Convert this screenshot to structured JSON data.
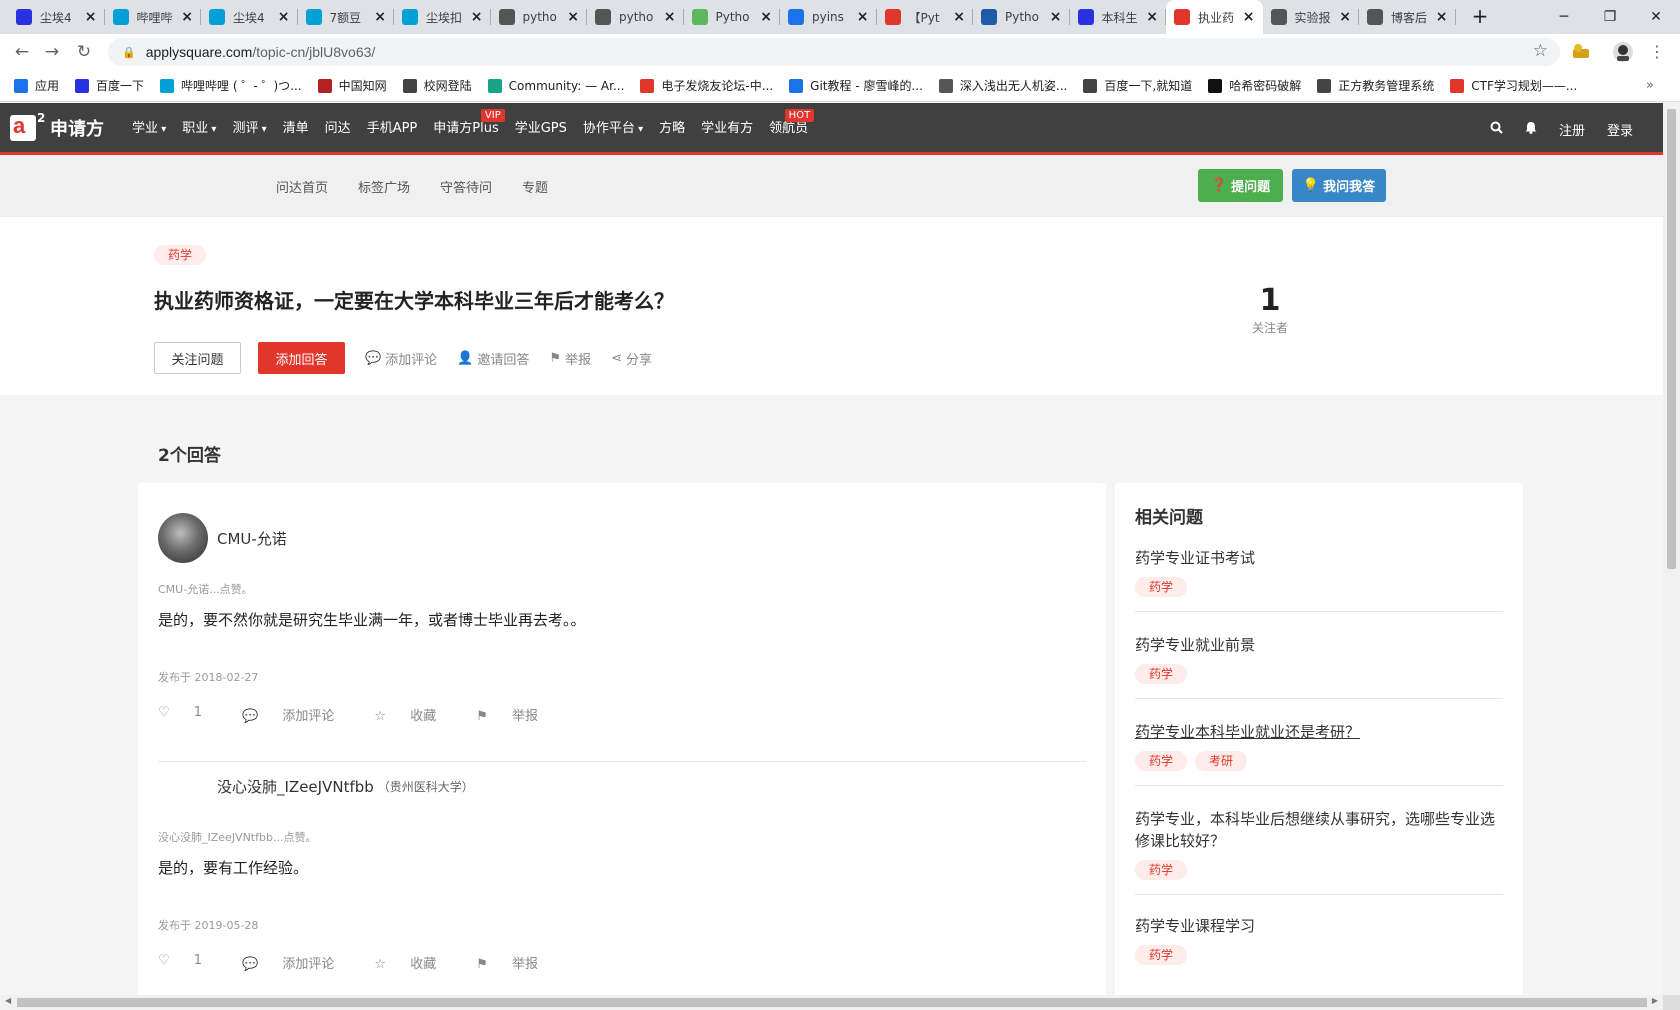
{
  "browser": {
    "tabs": [
      {
        "title": "尘埃4",
        "icon": "baidu-paw-icon",
        "color": "#2932e1"
      },
      {
        "title": "哔哩哔",
        "icon": "bilibili-icon",
        "color": "#00a1d6"
      },
      {
        "title": "尘埃4",
        "icon": "bilibili-icon",
        "color": "#00a1d6"
      },
      {
        "title": "7额豆",
        "icon": "bilibili-icon",
        "color": "#00a1d6"
      },
      {
        "title": "尘埃扣",
        "icon": "bilibili-icon",
        "color": "#00a1d6"
      },
      {
        "title": "pytho",
        "icon": "liaoxuefeng-icon",
        "color": "#555555"
      },
      {
        "title": "pytho",
        "icon": "liaoxuefeng-icon",
        "color": "#555555"
      },
      {
        "title": "Pytho",
        "icon": "runoob-icon",
        "color": "#5cb85c"
      },
      {
        "title": "pyins",
        "icon": "shield-icon",
        "color": "#1a73e8"
      },
      {
        "title": "【Pyt",
        "icon": "csdn-icon",
        "color": "#e0362c"
      },
      {
        "title": "Pytho",
        "icon": "k-icon",
        "color": "#1e5aa8"
      },
      {
        "title": "本科生",
        "icon": "baidu-paw-icon",
        "color": "#2932e1"
      },
      {
        "title": "执业药",
        "icon": "applysquare-icon",
        "color": "#e0362c",
        "active": true
      },
      {
        "title": "实验报",
        "icon": "liaoxuefeng-icon",
        "color": "#555555"
      },
      {
        "title": "博客后",
        "icon": "liaoxuefeng-icon",
        "color": "#555555"
      }
    ],
    "new_tab": "+",
    "window_controls": {
      "minimize": "─",
      "restore": "❐",
      "close": "✕"
    },
    "url": {
      "host": "applysquare.com",
      "path": "/topic-cn/jblU8vo63/"
    },
    "bookmarks": [
      {
        "label": "应用",
        "icon": "apps-grid-icon",
        "color": "#1a73e8"
      },
      {
        "label": "百度一下",
        "icon": "baidu-paw-icon",
        "color": "#2932e1"
      },
      {
        "label": "哔哩哔哩 ( ゜- ゜)つ...",
        "icon": "bilibili-icon",
        "color": "#00a1d6"
      },
      {
        "label": "中国知网",
        "icon": "cnki-icon",
        "color": "#b22222"
      },
      {
        "label": "校网登陆",
        "icon": "globe-icon",
        "color": "#444444"
      },
      {
        "label": "Community: — Ar...",
        "icon": "community-icon",
        "color": "#17a589"
      },
      {
        "label": "电子发烧友论坛-中...",
        "icon": "elecfans-icon",
        "color": "#e0362c"
      },
      {
        "label": "Git教程 - 廖雪峰的...",
        "icon": "rocket-icon",
        "color": "#1a73e8"
      },
      {
        "label": "深入浅出无人机姿...",
        "icon": "liaoxuefeng-icon",
        "color": "#555555"
      },
      {
        "label": "百度一下,就知道",
        "icon": "globe-icon",
        "color": "#444444"
      },
      {
        "label": "哈希密码破解",
        "icon": "hash-icon",
        "color": "#111111"
      },
      {
        "label": "正方教务管理系统",
        "icon": "globe-icon",
        "color": "#444444"
      },
      {
        "label": "CTF学习规划——...",
        "icon": "csdn-icon",
        "color": "#e0362c"
      }
    ],
    "bookmarks_more": "»"
  },
  "site": {
    "logo_text": "申请方",
    "logo_sup": "2",
    "nav": [
      {
        "label": "学业",
        "dropdown": true
      },
      {
        "label": "职业",
        "dropdown": true
      },
      {
        "label": "测评",
        "dropdown": true
      },
      {
        "label": "清单"
      },
      {
        "label": "问达",
        "active": true
      },
      {
        "label": "手机APP"
      },
      {
        "label": "申请方Plus",
        "badge": "VIP"
      },
      {
        "label": "学业GPS"
      },
      {
        "label": "协作平台",
        "dropdown": true
      },
      {
        "label": "方略"
      },
      {
        "label": "学业有方"
      },
      {
        "label": "领航员",
        "badge": "HOT"
      }
    ],
    "nav_right": {
      "register": "注册",
      "login": "登录"
    },
    "subnav": [
      "问达首页",
      "标签广场",
      "守答待问",
      "专题"
    ],
    "ask_button": "提问题",
    "answer_button": "我问我答"
  },
  "question": {
    "tag": "药学",
    "title": "执业药师资格证，一定要在大学本科毕业三年后才能考么？",
    "follow_label": "关注问题",
    "add_answer_label": "添加回答",
    "actions": [
      "添加评论",
      "邀请回答",
      "举报",
      "分享"
    ],
    "followers_count": "1",
    "followers_label": "关注者"
  },
  "answers_heading": "2个回答",
  "answers": [
    {
      "author": "CMU-允诺",
      "school": "",
      "likes_text": "CMU-允诺...点赞。",
      "text": "是的，要不然你就是研究生毕业满一年，或者博士毕业再去考。。",
      "date": "发布于 2018-02-27",
      "like_count": "1",
      "actions": [
        "添加评论",
        "收藏",
        "举报"
      ]
    },
    {
      "author": "没心没肺_IZeeJVNtfbb",
      "school": "（贵州医科大学）",
      "likes_text": "没心没肺_IZeeJVNtfbb...点赞。",
      "text": "是的，要有工作经验。",
      "date": "发布于 2019-05-28",
      "like_count": "1",
      "actions": [
        "添加评论",
        "收藏",
        "举报"
      ]
    }
  ],
  "related": {
    "title": "相关问题",
    "items": [
      {
        "question": "药学专业证书考试",
        "tags": [
          "药学"
        ]
      },
      {
        "question": "药学专业就业前景",
        "tags": [
          "药学"
        ]
      },
      {
        "question": "药学专业本科毕业就业还是考研？",
        "tags": [
          "药学",
          "考研"
        ],
        "hover": true
      },
      {
        "question": "药学专业，本科毕业后想继续从事研究，选哪些专业选修课比较好？",
        "tags": [
          "药学"
        ]
      },
      {
        "question": "药学专业课程学习",
        "tags": [
          "药学"
        ]
      }
    ]
  }
}
